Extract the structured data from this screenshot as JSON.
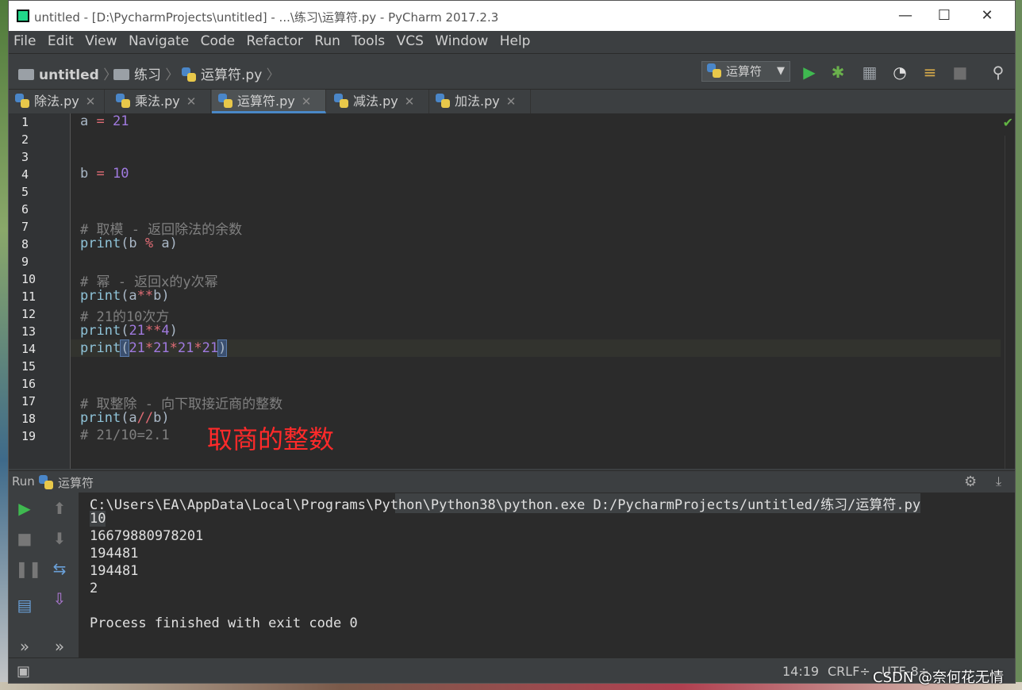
{
  "window": {
    "title": "untitled - [D:\\PycharmProjects\\untitled] - ...\\练习\\运算符.py - PyCharm 2017.2.3",
    "minimize": "—",
    "maximize": "☐",
    "close": "✕"
  },
  "menu": [
    "File",
    "Edit",
    "View",
    "Navigate",
    "Code",
    "Refactor",
    "Run",
    "Tools",
    "VCS",
    "Window",
    "Help"
  ],
  "breadcrumb": {
    "project": "untitled",
    "folder": "练习",
    "file": "运算符.py"
  },
  "run_config": "运算符",
  "tabs": [
    {
      "label": "除法.py",
      "active": false
    },
    {
      "label": "乘法.py",
      "active": false
    },
    {
      "label": "运算符.py",
      "active": true
    },
    {
      "label": "减法.py",
      "active": false
    },
    {
      "label": "加法.py",
      "active": false
    }
  ],
  "code": {
    "line_numbers": [
      "1",
      "2",
      "3",
      "4",
      "5",
      "6",
      "7",
      "8",
      "9",
      "10",
      "11",
      "12",
      "13",
      "14",
      "15",
      "16",
      "17",
      "18",
      "19"
    ],
    "l1_a": "a",
    "l1_eq": " = ",
    "l1_num": "21",
    "l4_b": "b",
    "l4_eq": " = ",
    "l4_num": "10",
    "l7": "# 取模 - 返回除法的余数",
    "l8_fn": "print",
    "l8_a": "(b ",
    "l8_op": "%",
    "l8_b": " a)",
    "l10": "# 幂 - 返回x的y次幂",
    "l11_fn": "print",
    "l11_a": "(a",
    "l11_op": "**",
    "l11_b": "b)",
    "l12": "# 21的10次方",
    "l13_fn": "print",
    "l13_a": "(",
    "l13_n1": "21",
    "l13_op": "**",
    "l13_n2": "4",
    "l13_b": ")",
    "l14_fn": "print",
    "l14_lp": "(",
    "l14_n1": "21",
    "l14_o1": "*",
    "l14_n2": "21",
    "l14_o2": "*",
    "l14_n3": "21",
    "l14_o3": "*",
    "l14_n4": "21",
    "l14_rp": ")",
    "l17": "# 取整除 - 向下取接近商的整数",
    "l18_fn": "print",
    "l18_a": "(a",
    "l18_op": "//",
    "l18_b": "b)",
    "l19": "# 21/10=2.1"
  },
  "annotation": "取商的整数",
  "run_panel": {
    "label": "Run",
    "config": "运算符",
    "output": [
      "C:\\Users\\EA\\AppData\\Local\\Programs\\Python\\Python38\\python.exe D:/PycharmProjects/untitled/练习/运算符.py",
      "10",
      "16679880978201",
      "194481",
      "194481",
      "2",
      "",
      "Process finished with exit code 0"
    ]
  },
  "status": {
    "position": "14:19",
    "line_sep": "CRLF÷",
    "encoding": "UTF-8÷"
  },
  "watermark": "CSDN @奈何花无情",
  "colors": {
    "keyword": "#cc7832",
    "number": "#a07adf",
    "comment": "#808080",
    "builtin": "#8888c6",
    "operator": "#e06c75",
    "accent": "#4a88c7"
  }
}
